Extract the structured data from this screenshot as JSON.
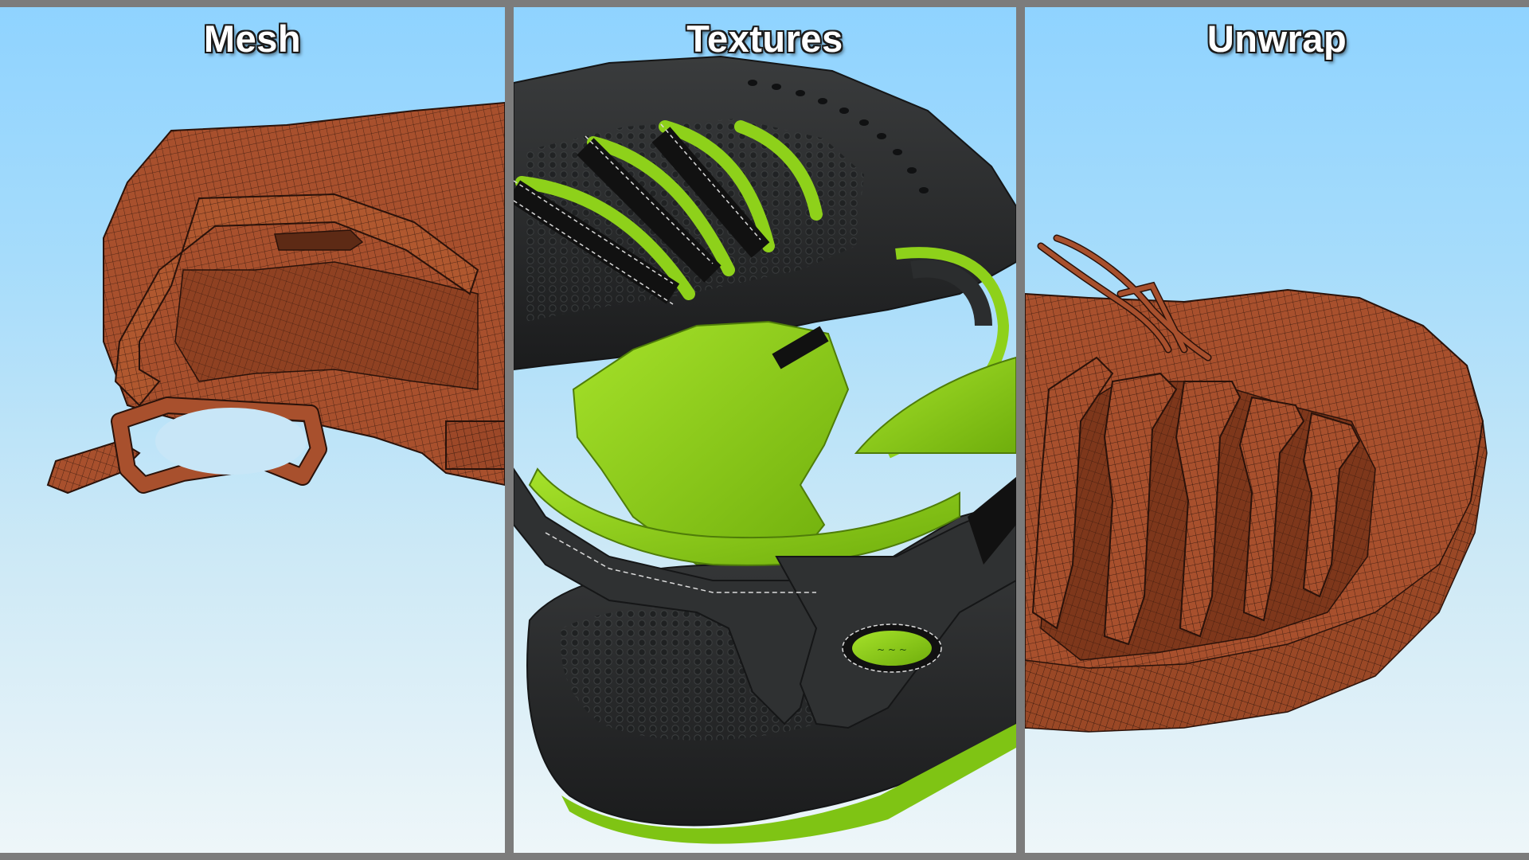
{
  "panels": {
    "mesh": {
      "title": "Mesh"
    },
    "textures": {
      "title": "Textures"
    },
    "unwrap": {
      "title": "Unwrap"
    }
  },
  "colors": {
    "frame": "#7c7c7c",
    "mesh_fill": "#a8502d",
    "wire": "#2a120a",
    "sandal_black": "#2b2d2e",
    "sandal_green": "#8ed11a"
  }
}
